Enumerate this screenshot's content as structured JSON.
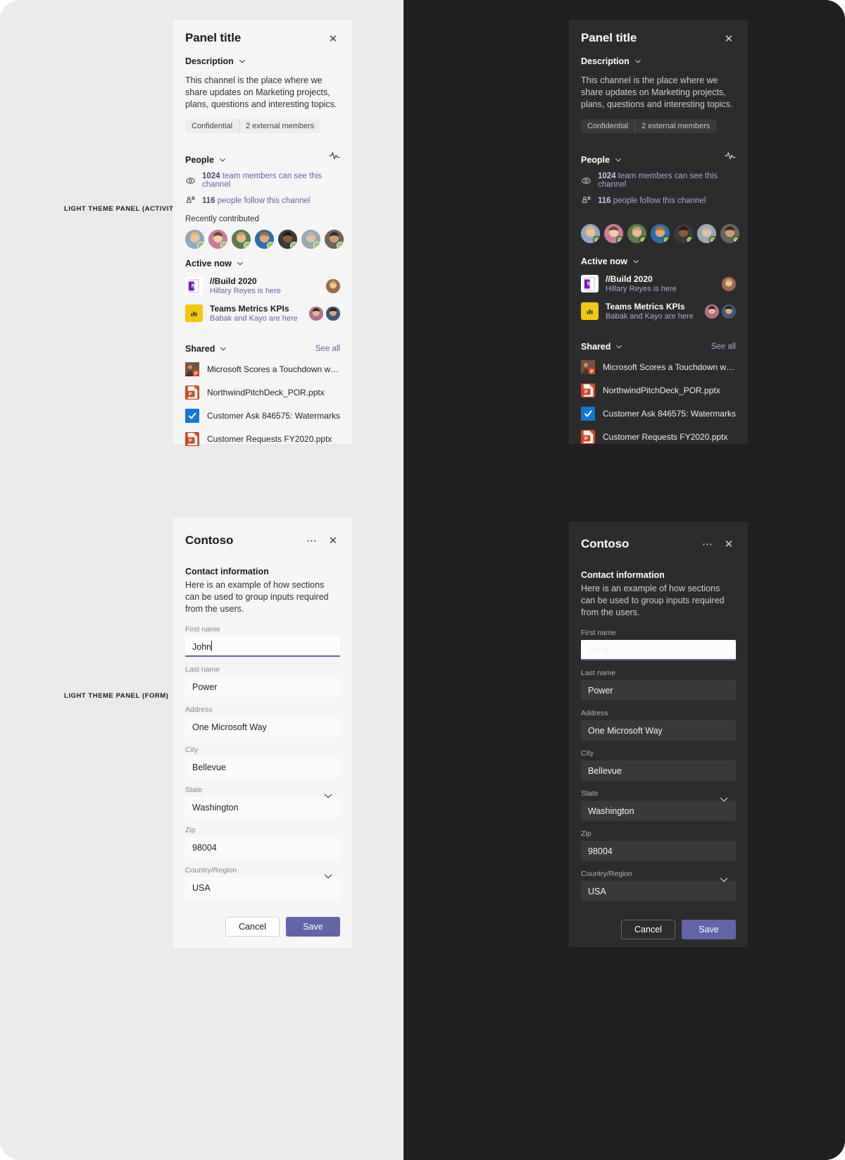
{
  "annotations": [
    {
      "label": "LIGHT THEME PANEL (ACTIVITY)"
    },
    {
      "label": "LIGHT THEME PANEL (FORM)"
    }
  ],
  "activity_panel": {
    "title": "Panel title",
    "close_icon": "close-icon",
    "description_section": {
      "label": "Description",
      "text": "This channel is the place where we share updates on Marketing projects, plans, questions and interesting topics."
    },
    "tags": [
      "Confidential",
      "2 external members"
    ],
    "activity_icon": "pulse-icon",
    "people_section": {
      "label": "People",
      "info": [
        {
          "icon": "eye-icon",
          "count": "1024",
          "text": "team members can see this channel"
        },
        {
          "icon": "follow-icon",
          "count": "116",
          "text": "people follow this channel"
        }
      ],
      "recently_contributed_label": "Recently contributed",
      "avatars": [
        {
          "name": "avatar-1",
          "skin": "#e8c39a",
          "hair": "#e8b96a",
          "shirt": "#8fa6c4",
          "presence": "available"
        },
        {
          "name": "avatar-2",
          "skin": "#f0cdab",
          "hair": "#6b4a35",
          "shirt": "#c77c9c",
          "presence": "available"
        },
        {
          "name": "avatar-3",
          "skin": "#e4b98f",
          "hair": "#c9a06a",
          "shirt": "#5f7a52",
          "presence": "available"
        },
        {
          "name": "avatar-4",
          "skin": "#e0a878",
          "hair": "#c06a2a",
          "shirt": "#2b6fae",
          "presence": "available"
        },
        {
          "name": "avatar-5",
          "skin": "#8a5a3b",
          "hair": "#2a1a12",
          "shirt": "#3a3a3a",
          "presence": "available"
        },
        {
          "name": "avatar-6",
          "skin": "#dcc0a8",
          "hair": "#b9b4ae",
          "shirt": "#9aa7b4",
          "presence": "available"
        },
        {
          "name": "avatar-7",
          "skin": "#cf9d74",
          "hair": "#3a2a20",
          "shirt": "#6b6560",
          "presence": "available"
        }
      ]
    },
    "active_now_section": {
      "label": "Active now",
      "items": [
        {
          "icon": "onenote-icon",
          "icon_letter": "N",
          "icon_color": "#7719aa",
          "title": "//Build 2020",
          "subtitle": "Hillary Reyes is here",
          "avatars": [
            {
              "name": "avatar-hillary",
              "skin": "#e8c39a",
              "hair": "#d89a55",
              "shirt": "#9b6b4a"
            }
          ]
        },
        {
          "icon": "powerbi-icon",
          "icon_letter": "",
          "icon_color": "#f2c811",
          "title": "Teams Metrics KPIs",
          "subtitle": "Babak and Kayo are here",
          "avatars": [
            {
              "name": "avatar-babak",
              "skin": "#e4b68c",
              "hair": "#2b1d16",
              "shirt": "#b0728a"
            },
            {
              "name": "avatar-kayo",
              "skin": "#d9a97f",
              "hair": "#241a14",
              "shirt": "#3f5a78"
            }
          ]
        }
      ]
    },
    "shared_section": {
      "label": "Shared",
      "see_all_label": "See all",
      "files": [
        {
          "name": "Microsoft Scores a Touchdown with NF...",
          "icon": "image-thumbnail-icon",
          "icon_color": "#b7472a",
          "icon_letter": "P"
        },
        {
          "name": "NorthwindPitchDeck_POR.pptx",
          "icon": "powerpoint-icon",
          "icon_color": "#d24726",
          "icon_letter": "P"
        },
        {
          "name": "Customer Ask 846575: Watermarks",
          "icon": "planner-icon",
          "icon_color": "#0078d4",
          "icon_letter": ""
        },
        {
          "name": "Customer Requests FY2020.pptx",
          "icon": "powerpoint-icon",
          "icon_color": "#d24726",
          "icon_letter": "P"
        }
      ]
    }
  },
  "form_panel": {
    "title": "Contoso",
    "more_icon": "more-options-icon",
    "close_icon": "close-icon",
    "section_title": "Contact information",
    "section_desc": "Here is an example of how sections can be used to group inputs required from the users.",
    "fields": [
      {
        "label": "First name",
        "value": "John",
        "type": "text",
        "focused": true
      },
      {
        "label": "Last name",
        "value": "Power",
        "type": "text",
        "focused": false
      },
      {
        "label": "Address",
        "value": "One Microsoft Way",
        "type": "text",
        "focused": false
      },
      {
        "label": "City",
        "value": "Bellevue",
        "type": "text",
        "focused": false
      },
      {
        "label": "State",
        "value": "Washington",
        "type": "select",
        "focused": false
      },
      {
        "label": "Zip",
        "value": "98004",
        "type": "text",
        "focused": false
      },
      {
        "label": "Country/Region",
        "value": "USA",
        "type": "select",
        "focused": false
      }
    ],
    "cancel_label": "Cancel",
    "save_label": "Save"
  },
  "colors": {
    "accent": "#6264a7",
    "light_panel_bg": "#f5f5f5",
    "dark_panel_bg": "#2d2c2c",
    "dark_stage_bg": "#201f1f",
    "light_stage_bg": "#eaeaea",
    "presence_available": "#92c353"
  }
}
